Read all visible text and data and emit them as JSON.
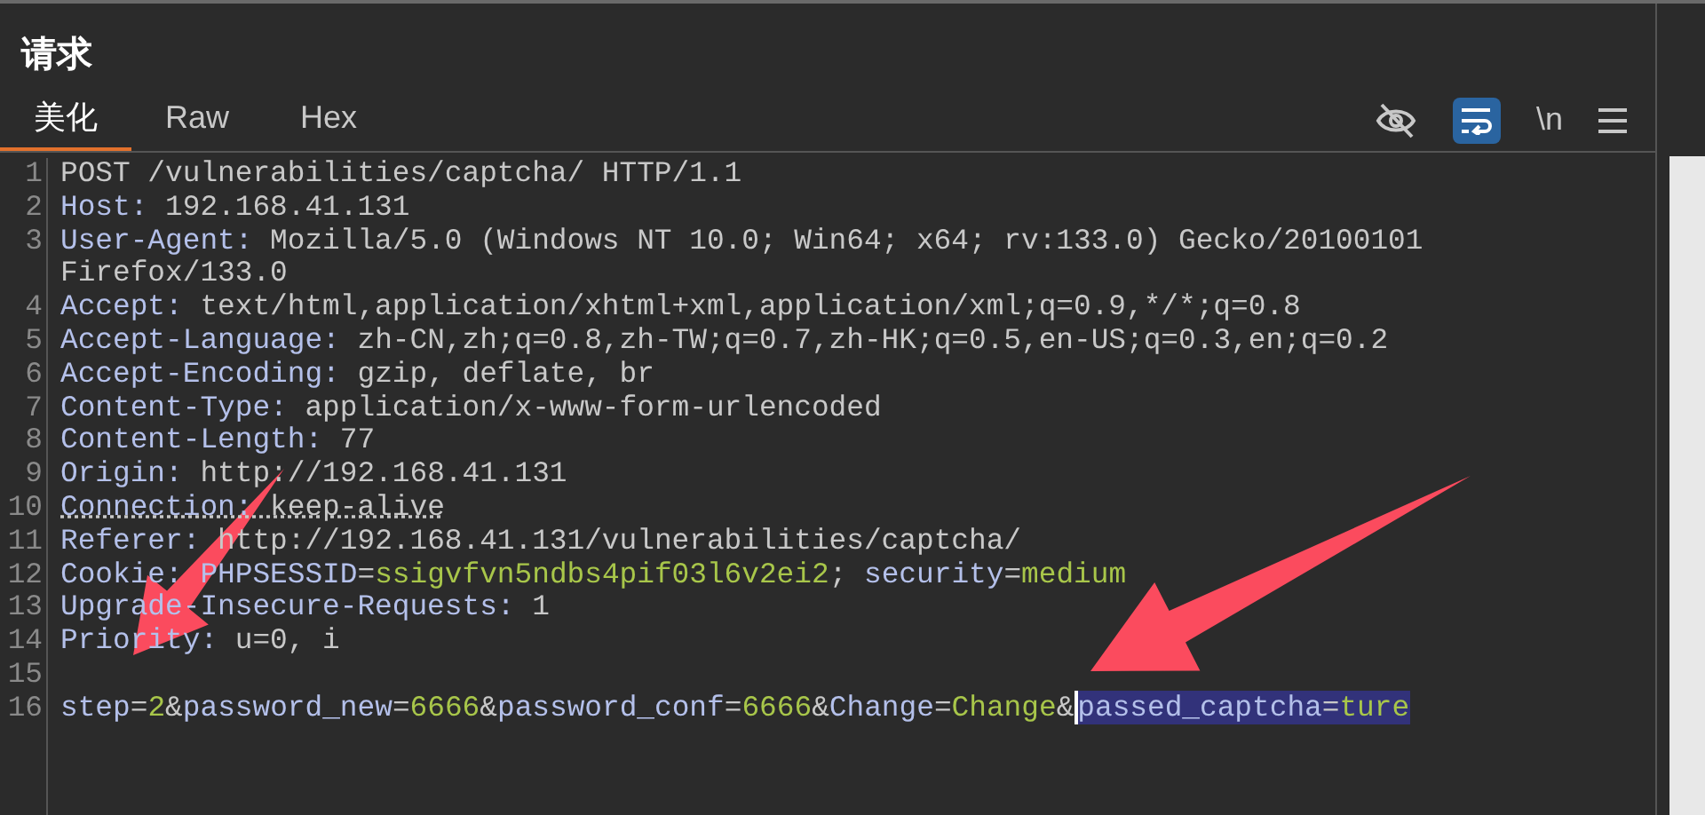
{
  "panel": {
    "title": "请求"
  },
  "tabs": [
    {
      "label": "美化",
      "selected": true
    },
    {
      "label": "Raw",
      "selected": false
    },
    {
      "label": "Hex",
      "selected": false
    }
  ],
  "toolbar": {
    "wrap_selected": true,
    "newline_label": "\\n"
  },
  "lines": [
    {
      "number": "1",
      "underlined": false,
      "segments": [
        {
          "kind": "text",
          "text": "POST /vulnerabilities/captcha/ HTTP/1.1",
          "selected": false
        }
      ]
    },
    {
      "number": "2",
      "underlined": false,
      "segments": [
        {
          "kind": "name",
          "text": "Host:",
          "selected": false
        },
        {
          "kind": "text",
          "text": " 192.168.41.131",
          "selected": false
        }
      ]
    },
    {
      "number": "3",
      "underlined": false,
      "segments": [
        {
          "kind": "name",
          "text": "User-Agent:",
          "selected": false
        },
        {
          "kind": "text",
          "text": " Mozilla/5.0 (Windows NT 10.0; Win64; x64; rv:133.0) Gecko/20100101",
          "selected": false
        }
      ]
    },
    {
      "underlined": false,
      "segments": [
        {
          "kind": "text",
          "text": "Firefox/133.0",
          "selected": false
        }
      ]
    },
    {
      "number": "4",
      "underlined": false,
      "segments": [
        {
          "kind": "name",
          "text": "Accept:",
          "selected": false
        },
        {
          "kind": "text",
          "text": " text/html,application/xhtml+xml,application/xml;q=0.9,*/*;q=0.8",
          "selected": false
        }
      ]
    },
    {
      "number": "5",
      "underlined": false,
      "segments": [
        {
          "kind": "name",
          "text": "Accept-Language:",
          "selected": false
        },
        {
          "kind": "text",
          "text": " zh-CN,zh;q=0.8,zh-TW;q=0.7,zh-HK;q=0.5,en-US;q=0.3,en;q=0.2",
          "selected": false
        }
      ]
    },
    {
      "number": "6",
      "underlined": false,
      "segments": [
        {
          "kind": "name",
          "text": "Accept-Encoding:",
          "selected": false
        },
        {
          "kind": "text",
          "text": " gzip, deflate, br",
          "selected": false
        }
      ]
    },
    {
      "number": "7",
      "underlined": false,
      "segments": [
        {
          "kind": "name",
          "text": "Content-Type:",
          "selected": false
        },
        {
          "kind": "text",
          "text": " application/x-www-form-urlencoded",
          "selected": false
        }
      ]
    },
    {
      "number": "8",
      "underlined": false,
      "segments": [
        {
          "kind": "name",
          "text": "Content-Length:",
          "selected": false
        },
        {
          "kind": "text",
          "text": " 77",
          "selected": false
        }
      ]
    },
    {
      "number": "9",
      "underlined": false,
      "segments": [
        {
          "kind": "name",
          "text": "Origin:",
          "selected": false
        },
        {
          "kind": "text",
          "text": " http://192.168.41.131",
          "selected": false
        }
      ]
    },
    {
      "number": "10",
      "underlined": true,
      "segments": [
        {
          "kind": "name",
          "text": "Connection:",
          "selected": false
        },
        {
          "kind": "text",
          "text": " keep-alive",
          "selected": false
        }
      ]
    },
    {
      "number": "11",
      "underlined": false,
      "segments": [
        {
          "kind": "name",
          "text": "Referer:",
          "selected": false
        },
        {
          "kind": "text",
          "text": " http://192.168.41.131/vulnerabilities/captcha/",
          "selected": false
        }
      ]
    },
    {
      "number": "12",
      "underlined": false,
      "segments": [
        {
          "kind": "name",
          "text": "Cookie:",
          "selected": false
        },
        {
          "kind": "name",
          "text": " PHPSESSID",
          "selected": false
        },
        {
          "kind": "text",
          "text": "=",
          "selected": false
        },
        {
          "kind": "value",
          "text": "ssigvfvn5ndbs4pif03l6v2ei2",
          "selected": false
        },
        {
          "kind": "text",
          "text": ";",
          "selected": false
        },
        {
          "kind": "name",
          "text": " security",
          "selected": false
        },
        {
          "kind": "text",
          "text": "=",
          "selected": false
        },
        {
          "kind": "value",
          "text": "medium",
          "selected": false
        }
      ]
    },
    {
      "number": "13",
      "underlined": false,
      "segments": [
        {
          "kind": "name",
          "text": "Upgrade-Insecure-Requests:",
          "selected": false
        },
        {
          "kind": "text",
          "text": " 1",
          "selected": false
        }
      ]
    },
    {
      "number": "14",
      "underlined": false,
      "segments": [
        {
          "kind": "name",
          "text": "Priority:",
          "selected": false
        },
        {
          "kind": "text",
          "text": " u=0, i",
          "selected": false
        }
      ]
    },
    {
      "number": "15"
    },
    {
      "number": "16",
      "underlined": false,
      "segments": [
        {
          "kind": "name",
          "text": "step",
          "selected": false
        },
        {
          "kind": "text",
          "text": "=",
          "selected": false
        },
        {
          "kind": "value",
          "text": "2",
          "selected": false
        },
        {
          "kind": "text",
          "text": "&",
          "selected": false
        },
        {
          "kind": "name",
          "text": "password_new",
          "selected": false
        },
        {
          "kind": "text",
          "text": "=",
          "selected": false
        },
        {
          "kind": "value",
          "text": "6666",
          "selected": false
        },
        {
          "kind": "text",
          "text": "&",
          "selected": false
        },
        {
          "kind": "name",
          "text": "password_conf",
          "selected": false
        },
        {
          "kind": "text",
          "text": "=",
          "selected": false
        },
        {
          "kind": "value",
          "text": "6666",
          "selected": false
        },
        {
          "kind": "text",
          "text": "&",
          "selected": false
        },
        {
          "kind": "name",
          "text": "Change",
          "selected": false
        },
        {
          "kind": "text",
          "text": "=",
          "selected": false
        },
        {
          "kind": "value",
          "text": "Change",
          "selected": false
        },
        {
          "kind": "text",
          "text": "&",
          "selected": false
        },
        {
          "kind": "name",
          "text": "passed_captcha",
          "selected": true
        },
        {
          "kind": "text",
          "text": "=",
          "selected": true
        },
        {
          "kind": "value",
          "text": "ture",
          "selected": true
        }
      ]
    }
  ]
}
